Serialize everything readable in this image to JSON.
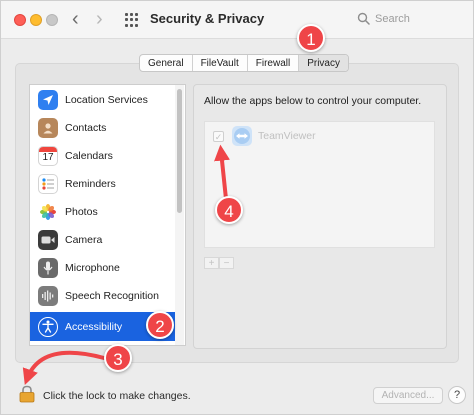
{
  "window": {
    "title": "Security & Privacy",
    "search_placeholder": "Search"
  },
  "tabs": [
    {
      "label": "General",
      "active": false
    },
    {
      "label": "FileVault",
      "active": false
    },
    {
      "label": "Firewall",
      "active": false
    },
    {
      "label": "Privacy",
      "active": true
    }
  ],
  "sidebar": {
    "items": [
      {
        "label": "Location Services",
        "icon": "location-arrow-icon"
      },
      {
        "label": "Contacts",
        "icon": "contacts-book-icon"
      },
      {
        "label": "Calendars",
        "icon": "calendar-icon",
        "icon_text": "17"
      },
      {
        "label": "Reminders",
        "icon": "reminders-list-icon"
      },
      {
        "label": "Photos",
        "icon": "photos-flower-icon"
      },
      {
        "label": "Camera",
        "icon": "camera-icon"
      },
      {
        "label": "Microphone",
        "icon": "microphone-icon"
      },
      {
        "label": "Speech Recognition",
        "icon": "speech-waveform-icon"
      },
      {
        "label": "Accessibility",
        "icon": "accessibility-person-icon",
        "selected": true
      }
    ]
  },
  "detail": {
    "description": "Allow the apps below to control your computer.",
    "apps": [
      {
        "name": "TeamViewer",
        "checked": true,
        "enabled": false,
        "icon": "teamviewer-icon"
      }
    ],
    "add_label": "+",
    "remove_label": "−"
  },
  "footer": {
    "lock_text": "Click the lock to make changes.",
    "advanced_label": "Advanced...",
    "help_label": "?"
  },
  "annotations": [
    {
      "number": "1",
      "color": "#ef4548"
    },
    {
      "number": "2",
      "color": "#ef4548"
    },
    {
      "number": "3",
      "color": "#ef4548"
    },
    {
      "number": "4",
      "color": "#ef4548"
    }
  ],
  "colors": {
    "accent": "#1a63e0",
    "annotation": "#ef4548"
  }
}
